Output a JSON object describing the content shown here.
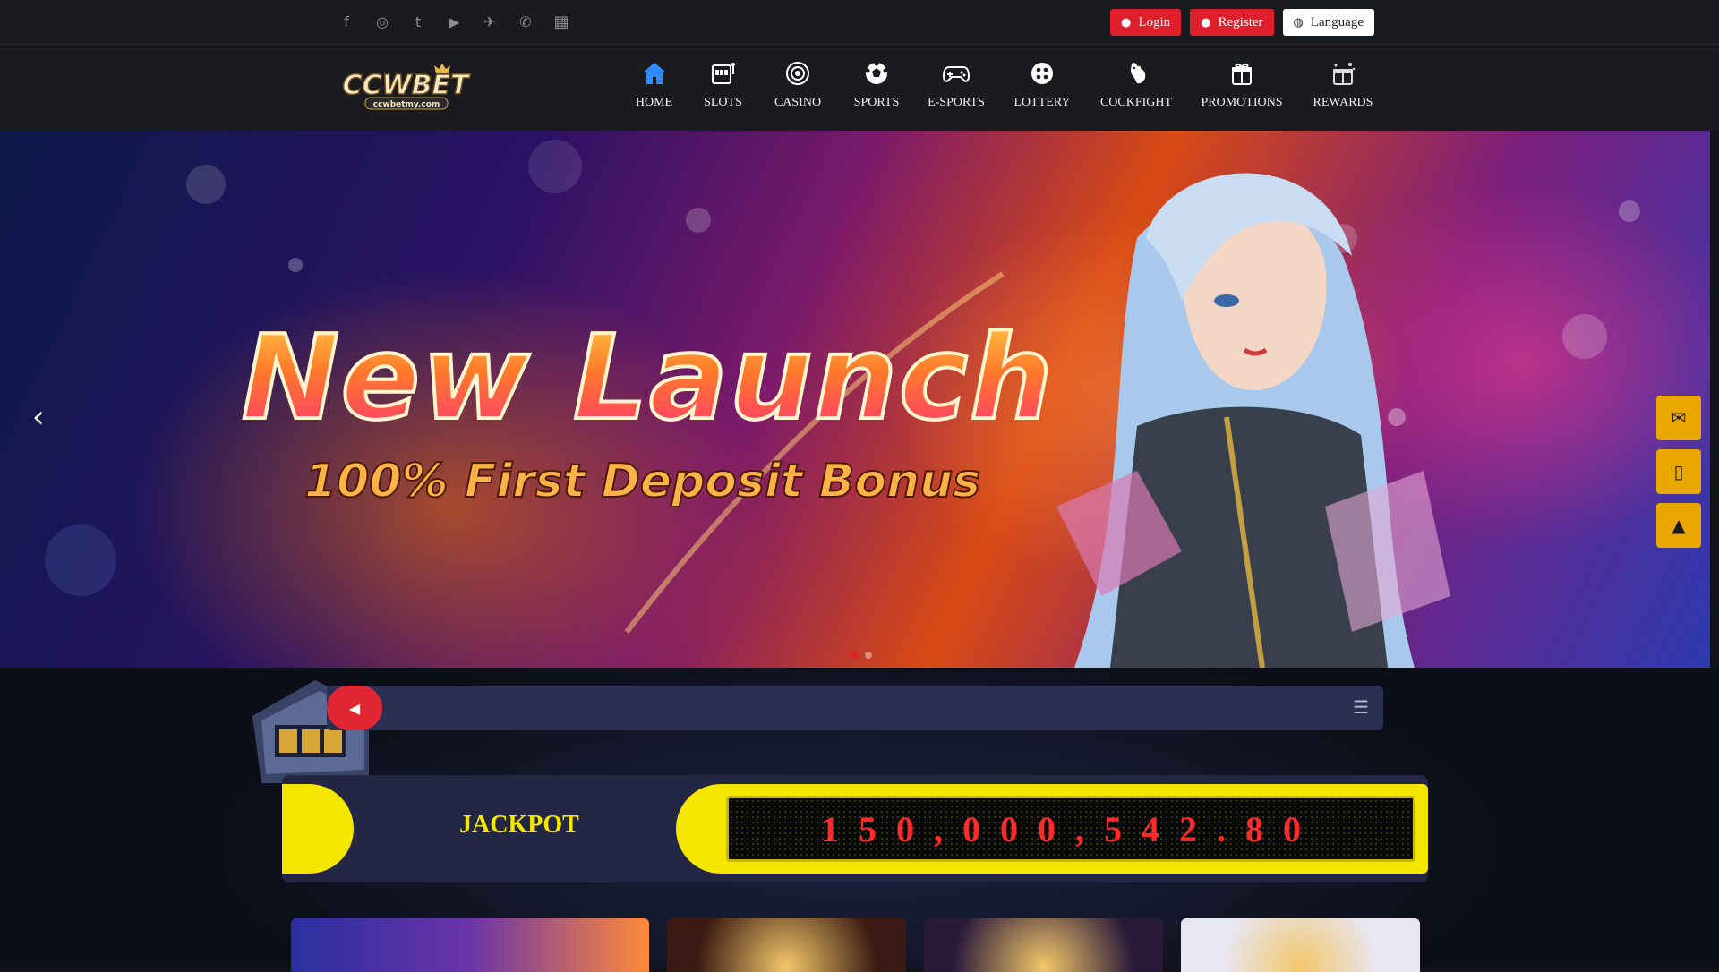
{
  "topbar": {
    "social_icons": [
      "facebook-icon",
      "instagram-icon",
      "twitter-icon",
      "youtube-icon",
      "telegram-icon",
      "whatsapp-icon",
      "qr-icon"
    ],
    "login_label": "Login",
    "register_label": "Register",
    "language_label": "Language",
    "colors": {
      "login_bg": "#e01f2d",
      "register_bg": "#e01f2d",
      "language_bg": "#ffffff"
    }
  },
  "brand": {
    "logo_text": "CCWBET",
    "logo_sub": "ccwbetmy.com"
  },
  "nav": {
    "items": [
      {
        "label": "HOME",
        "icon": "home-icon",
        "active": true
      },
      {
        "label": "SLOTS",
        "icon": "slot-machine-icon"
      },
      {
        "label": "CASINO",
        "icon": "casino-chip-icon"
      },
      {
        "label": "SPORTS",
        "icon": "soccer-ball-icon"
      },
      {
        "label": "E-SPORTS",
        "icon": "gamepad-icon"
      },
      {
        "label": "LOTTERY",
        "icon": "lottery-ball-icon"
      },
      {
        "label": "COCKFIGHT",
        "icon": "rooster-icon"
      },
      {
        "label": "PROMOTIONS",
        "icon": "gift-box-icon"
      },
      {
        "label": "REWARDS",
        "icon": "rewards-gift-icon"
      }
    ],
    "accent": "#2e8cff"
  },
  "banner": {
    "headline": "New Launch",
    "subline": "100% First Deposit Bonus",
    "slide_count": 2,
    "active_slide": 1
  },
  "side_tools": [
    "chat-icon",
    "mobile-icon",
    "top-icon"
  ],
  "marquee": {
    "speaker_icon": "speaker-icon",
    "more_icon": "menu-icon"
  },
  "jackpot": {
    "label": "JACKPOT",
    "value": "150,000,542.80",
    "colors": {
      "accent": "#f5e600",
      "digits": "#ff2a2a"
    }
  }
}
